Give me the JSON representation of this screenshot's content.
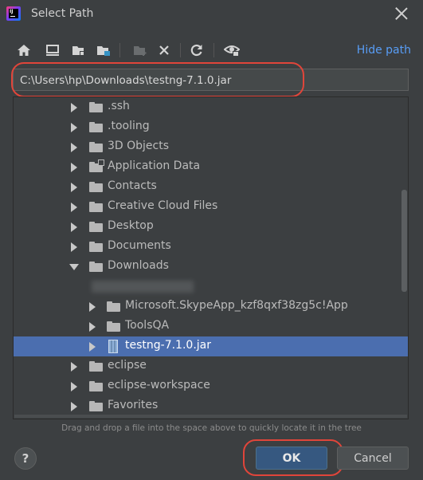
{
  "window": {
    "title": "Select Path",
    "app_icon": "intellij-idea-icon"
  },
  "toolbar": {
    "icons": [
      "home-icon",
      "desktop-icon",
      "project-folder-icon",
      "module-folder-icon",
      "new-folder-icon",
      "delete-icon",
      "refresh-icon",
      "show-hidden-icon"
    ],
    "hide_path_label": "Hide path"
  },
  "path": {
    "value": "C:\\Users\\hp\\Downloads\\testng-7.1.0.jar"
  },
  "tree": {
    "items": [
      {
        "label": ".ssh",
        "type": "folder",
        "expanded": false
      },
      {
        "label": ".tooling",
        "type": "folder",
        "expanded": false
      },
      {
        "label": "3D Objects",
        "type": "folder",
        "expanded": false
      },
      {
        "label": "Application Data",
        "type": "folder-shortcut",
        "expanded": false
      },
      {
        "label": "Contacts",
        "type": "folder",
        "expanded": false
      },
      {
        "label": "Creative Cloud Files",
        "type": "folder",
        "expanded": false
      },
      {
        "label": "Desktop",
        "type": "folder",
        "expanded": false
      },
      {
        "label": "Documents",
        "type": "folder",
        "expanded": false
      },
      {
        "label": "Downloads",
        "type": "folder",
        "expanded": true
      },
      {
        "label": "",
        "type": "blurred",
        "expanded": false
      },
      {
        "label": "Microsoft.SkypeApp_kzf8qxf38zg5c!App",
        "type": "folder",
        "expanded": false
      },
      {
        "label": "ToolsQA",
        "type": "folder",
        "expanded": false
      },
      {
        "label": "testng-7.1.0.jar",
        "type": "jar",
        "selected": true
      },
      {
        "label": "eclipse",
        "type": "folder",
        "expanded": false
      },
      {
        "label": "eclipse-workspace",
        "type": "folder",
        "expanded": false
      },
      {
        "label": "Favorites",
        "type": "folder",
        "expanded": false
      }
    ]
  },
  "footer": {
    "hint": "Drag and drop a file into the space above to quickly locate it in the tree",
    "help_label": "?",
    "ok_label": "OK",
    "cancel_label": "Cancel"
  },
  "colors": {
    "background": "#3c3f41",
    "selection": "#4b6eaf",
    "link": "#589df6",
    "highlight": "#e0453a",
    "ok_button": "#365880"
  }
}
